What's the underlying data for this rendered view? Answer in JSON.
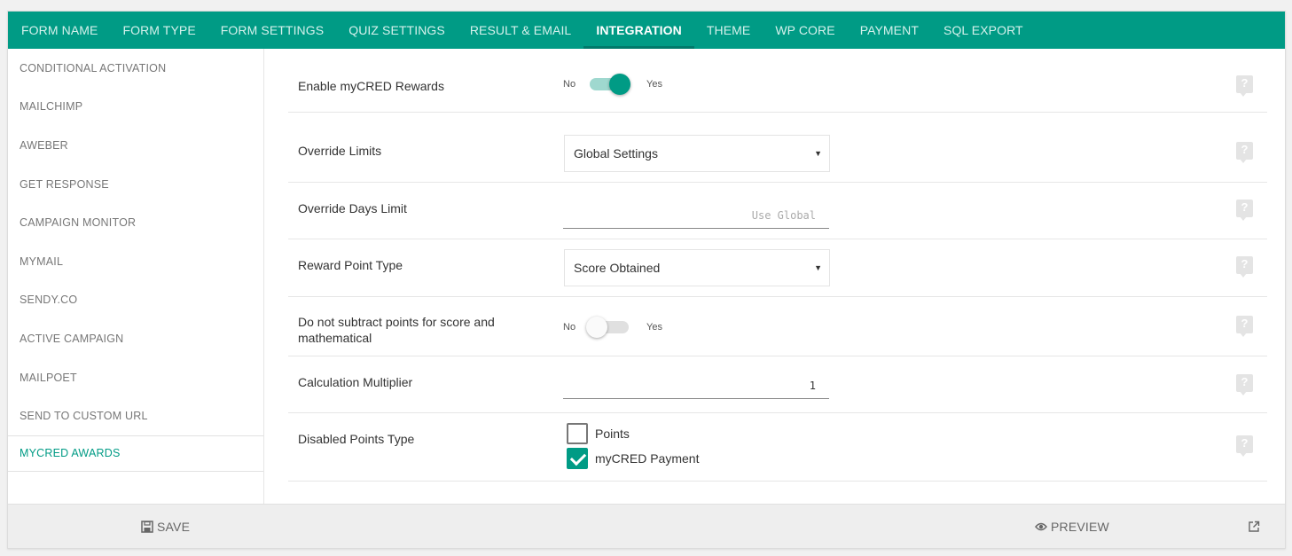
{
  "tabs": [
    {
      "label": "FORM NAME"
    },
    {
      "label": "FORM TYPE"
    },
    {
      "label": "FORM SETTINGS"
    },
    {
      "label": "QUIZ SETTINGS"
    },
    {
      "label": "RESULT & EMAIL"
    },
    {
      "label": "INTEGRATION",
      "active": true
    },
    {
      "label": "THEME"
    },
    {
      "label": "WP CORE"
    },
    {
      "label": "PAYMENT"
    },
    {
      "label": "SQL EXPORT"
    }
  ],
  "sidebar": {
    "items": [
      {
        "label": "CONDITIONAL ACTIVATION"
      },
      {
        "label": "MAILCHIMP"
      },
      {
        "label": "AWEBER"
      },
      {
        "label": "GET RESPONSE"
      },
      {
        "label": "CAMPAIGN MONITOR"
      },
      {
        "label": "MYMAIL"
      },
      {
        "label": "SENDY.CO"
      },
      {
        "label": "ACTIVE CAMPAIGN"
      },
      {
        "label": "MAILPOET"
      },
      {
        "label": "SEND TO CUSTOM URL"
      },
      {
        "label": "MYCRED AWARDS",
        "active": true
      }
    ]
  },
  "settings": {
    "enable_rewards": {
      "label": "Enable myCRED Rewards",
      "off_label": "No",
      "on_label": "Yes",
      "value": true
    },
    "override_limits": {
      "label": "Override Limits",
      "value": "Global Settings"
    },
    "override_days": {
      "label": "Override Days Limit",
      "placeholder": "Use Global"
    },
    "reward_point_type": {
      "label": "Reward Point Type",
      "value": "Score Obtained"
    },
    "no_subtract": {
      "label": "Do not subtract points for score and mathematical",
      "off_label": "No",
      "on_label": "Yes",
      "value": false
    },
    "multiplier": {
      "label": "Calculation Multiplier",
      "value": "1"
    },
    "disabled_points": {
      "label": "Disabled Points Type",
      "options": [
        {
          "label": "Points",
          "checked": false
        },
        {
          "label": "myCRED Payment",
          "checked": true
        }
      ]
    },
    "help_glyph": "?"
  },
  "footer": {
    "save_label": "SAVE",
    "preview_label": "PREVIEW"
  },
  "colors": {
    "accent": "#009b85",
    "accent_dark": "#00796a"
  },
  "icons": {
    "save": "floppy-disk-icon",
    "preview": "eye-icon",
    "external": "external-link-icon",
    "help": "help-icon"
  }
}
